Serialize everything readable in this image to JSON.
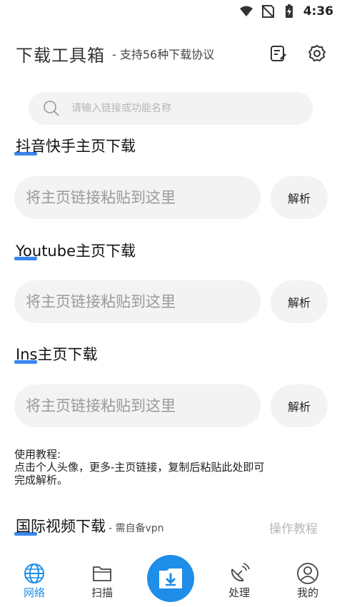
{
  "status_bar": {
    "time": "4:36"
  },
  "header": {
    "title": "下载工具箱",
    "subtitle": "- 支持56种下载协议",
    "icons": [
      "edit-note-icon",
      "settings-gear-icon"
    ]
  },
  "search": {
    "placeholder": "请输入链接或功能名称"
  },
  "sections": [
    {
      "title": "抖音快手主页下载",
      "input_placeholder": "将主页链接粘贴到这里",
      "button_label": "解析"
    },
    {
      "title": "Youtube主页下载",
      "input_placeholder": "将主页链接粘贴到这里",
      "button_label": "解析"
    },
    {
      "title": "Ins主页下载",
      "input_placeholder": "将主页链接粘贴到这里",
      "button_label": "解析"
    }
  ],
  "tutorial": {
    "heading": "使用教程:",
    "line1": "点击个人头像，更多-主页链接，复制后粘贴此处即可",
    "line2": "完成解析。"
  },
  "intl_section": {
    "title": "国际视频下载",
    "note": "- 需自备vpn",
    "ops_link": "操作教程"
  },
  "bottom_nav": {
    "items": [
      {
        "label": "网络",
        "icon": "globe-icon",
        "active": true
      },
      {
        "label": "扫描",
        "icon": "folder-icon",
        "active": false
      },
      {
        "label": "",
        "icon": "download-folder-icon",
        "active": false
      },
      {
        "label": "处理",
        "icon": "satellite-dish-icon",
        "active": false
      },
      {
        "label": "我的",
        "icon": "user-icon",
        "active": false
      }
    ]
  },
  "colors": {
    "accent": "#1e8ee8",
    "underline": "#3a86f0",
    "input_bg": "#f3f3f3"
  }
}
